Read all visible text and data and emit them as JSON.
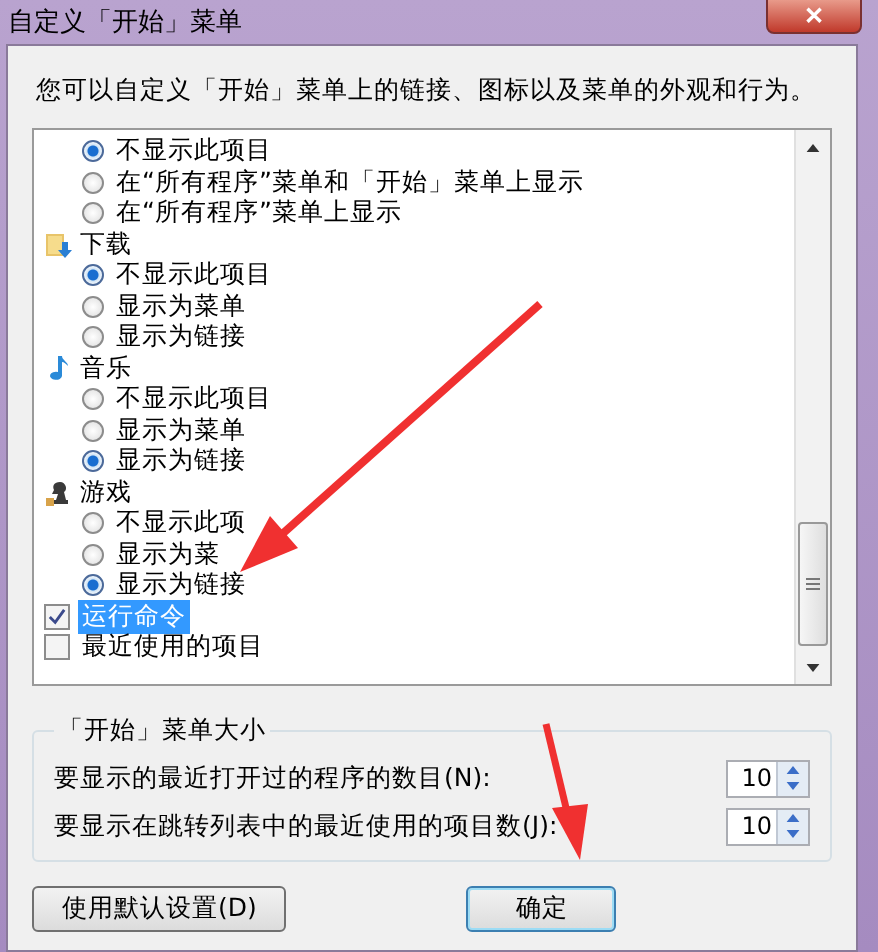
{
  "window": {
    "title": "自定义「开始」菜单",
    "close": "✕"
  },
  "description": "您可以自定义「开始」菜单上的链接、图标以及菜单的外观和行为。",
  "groups": [
    {
      "options": [
        {
          "label": "不显示此项目",
          "selected": true
        },
        {
          "label": "在“所有程序”菜单和「开始」菜单上显示",
          "selected": false
        },
        {
          "label": "在“所有程序”菜单上显示",
          "selected": false
        }
      ]
    },
    {
      "label": "下载",
      "options": [
        {
          "label": "不显示此项目",
          "selected": true
        },
        {
          "label": "显示为菜单",
          "selected": false
        },
        {
          "label": "显示为链接",
          "selected": false
        }
      ]
    },
    {
      "label": "音乐",
      "options": [
        {
          "label": "不显示此项目",
          "selected": false
        },
        {
          "label": "显示为菜单",
          "selected": false
        },
        {
          "label": "显示为链接",
          "selected": true
        }
      ]
    },
    {
      "label": "游戏",
      "options": [
        {
          "label": "不显示此项",
          "selected": false
        },
        {
          "label": "显示为菜",
          "selected": false
        },
        {
          "label": "显示为链接",
          "selected": true
        }
      ]
    }
  ],
  "checkboxes": [
    {
      "label": "运行命令",
      "checked": true,
      "selected": true
    },
    {
      "label": "最近使用的项目",
      "checked": false,
      "selected": false
    }
  ],
  "menu_size": {
    "title": "「开始」菜单大小",
    "fields": [
      {
        "label": "要显示的最近打开过的程序的数目(N):",
        "value": "10"
      },
      {
        "label": "要显示在跳转列表中的最近使用的项目数(J):",
        "value": "10"
      }
    ]
  },
  "buttons": [
    {
      "label": "使用默认设置(D)",
      "default": false
    },
    {
      "label": "确定",
      "default": true
    }
  ]
}
